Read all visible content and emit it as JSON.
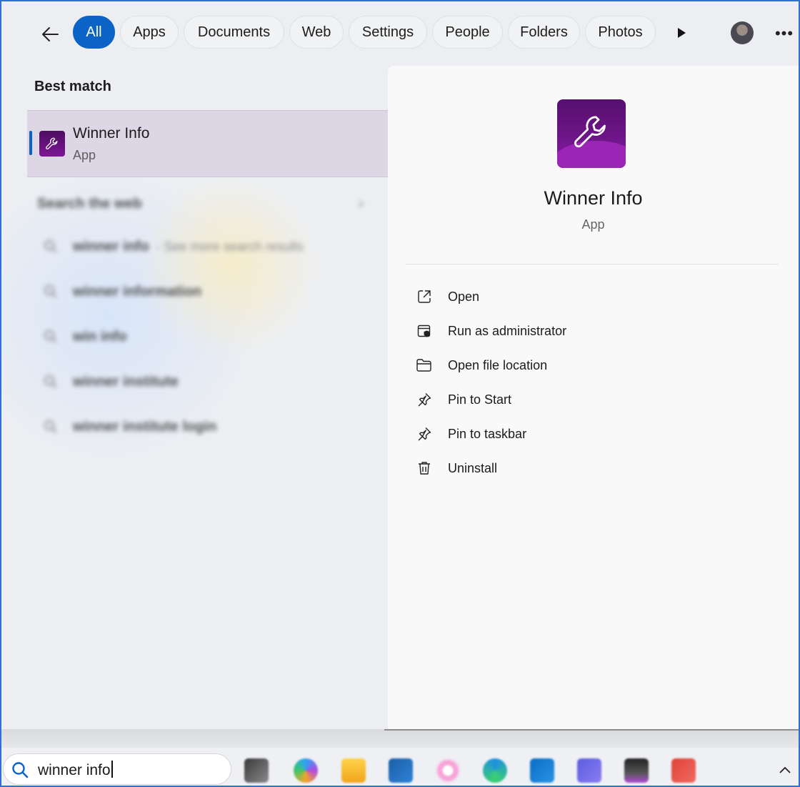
{
  "filters": {
    "back_label": "Back",
    "categories": [
      {
        "label": "All",
        "active": true
      },
      {
        "label": "Apps",
        "active": false
      },
      {
        "label": "Documents",
        "active": false
      },
      {
        "label": "Web",
        "active": false
      },
      {
        "label": "Settings",
        "active": false
      },
      {
        "label": "People",
        "active": false
      },
      {
        "label": "Folders",
        "active": false
      },
      {
        "label": "Photos",
        "active": false
      }
    ]
  },
  "results": {
    "best_match_title": "Best match",
    "best_match": {
      "name": "Winner Info",
      "type": "App"
    },
    "web_section": {
      "title": "Search the web",
      "suggestions": [
        {
          "query": "winner info",
          "hint": "- See more search results"
        },
        {
          "query": "winner information",
          "hint": ""
        },
        {
          "query": "win info",
          "hint": ""
        },
        {
          "query": "winner institute",
          "hint": ""
        },
        {
          "query": "winner institute login",
          "hint": ""
        }
      ]
    }
  },
  "detail": {
    "app_name": "Winner Info",
    "app_type": "App",
    "actions": [
      {
        "label": "Open",
        "icon": "open-external-icon"
      },
      {
        "label": "Run as administrator",
        "icon": "shield-admin-icon"
      },
      {
        "label": "Open file location",
        "icon": "folder-icon"
      },
      {
        "label": "Pin to Start",
        "icon": "pin-icon"
      },
      {
        "label": "Pin to taskbar",
        "icon": "pin-icon"
      },
      {
        "label": "Uninstall",
        "icon": "trash-icon"
      }
    ]
  },
  "taskbar": {
    "search_value": "winner info",
    "colors": {
      "accent": "#0b63c5",
      "selection_bg": "#ddd6e4",
      "app_icon": "#6d1588"
    }
  }
}
